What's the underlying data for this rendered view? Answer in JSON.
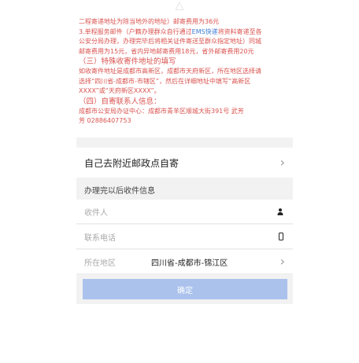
{
  "notice": {
    "line1": "二程寄递地址为除当地外的地址）邮寄费用为36元",
    "line2_pre": "3.单程服务邮件（户籍办理群众自行通过",
    "line2_link": "EMS快递",
    "line2_post": "将资料寄递至各",
    "line3": "公安分局办理，办理完毕后将相关证件寄送至群众指定地址）同城",
    "line4": "邮寄费用为15元，省内异地邮寄费用18元，省外邮寄费用20元",
    "heading3": "（三）特殊收寄件地址的填写",
    "line5": "如收寄件地址是成都市高新区，成都市天府新区，所在地区选择请",
    "line6": "选择“四川省-成都市-市辖区”，然后在详细地址中填写“高新区",
    "line7": "XXXX”或“天府新区XXXX”。",
    "heading4": "（四）自寄联系人信息：",
    "line8": "成都市公安局办证中心：成都市青羊区顺城大街391号 武芳",
    "line9": "芳 02886407753"
  },
  "self_send": {
    "label": "自己去附近邮政点自寄"
  },
  "receive_section": {
    "title": "办理完以后收件信息"
  },
  "fields": {
    "recipient": {
      "placeholder": "收件人"
    },
    "phone": {
      "placeholder": "联系电话"
    },
    "region": {
      "label": "所在地区",
      "value": "四川省-成都市-锦江区"
    }
  },
  "confirm": {
    "label": "确定"
  },
  "icons": {
    "chevron": "chevron-right-icon",
    "person": "person-icon",
    "phone": "phone-icon"
  },
  "colors": {
    "notice_text": "#d9534f",
    "link": "#3a7bd5",
    "confirm_bg": "#aac2ec"
  }
}
